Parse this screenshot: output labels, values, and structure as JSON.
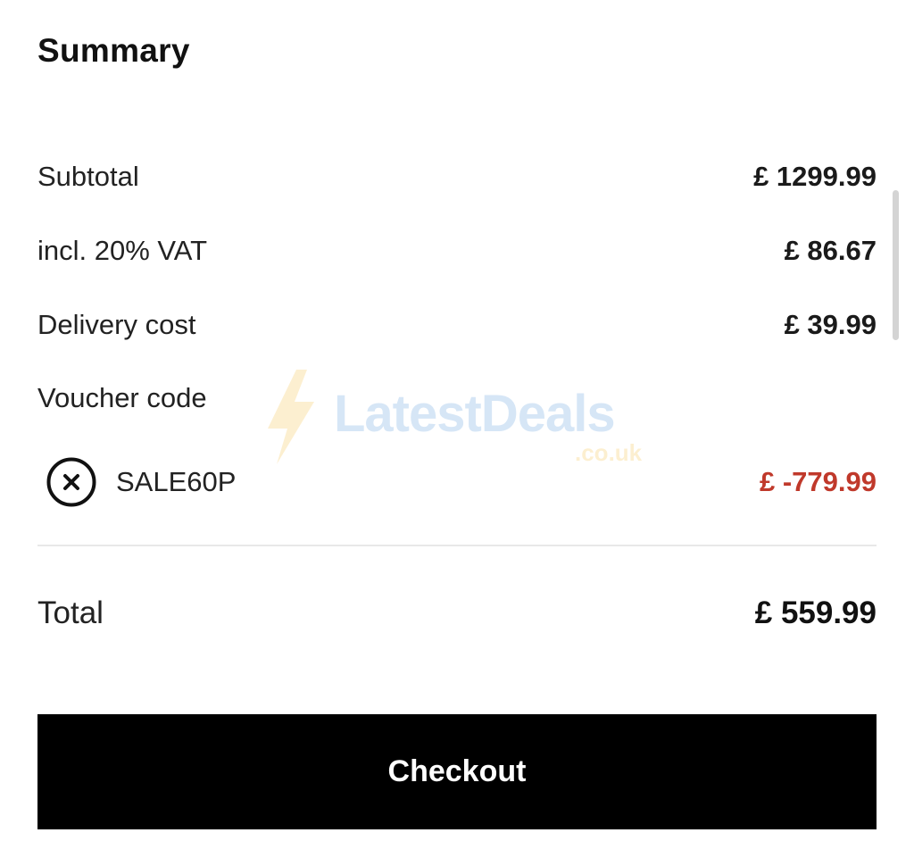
{
  "summary": {
    "title": "Summary",
    "rows": [
      {
        "label": "Subtotal",
        "value": "£ 1299.99"
      },
      {
        "label": "incl. 20% VAT",
        "value": "£ 86.67"
      },
      {
        "label": "Delivery cost",
        "value": "£ 39.99"
      }
    ],
    "voucher": {
      "label": "Voucher code",
      "code": "SALE60P",
      "discount": "£ -779.99",
      "remove_icon": "close-circle-icon"
    },
    "total": {
      "label": "Total",
      "value": "£ 559.99"
    },
    "checkout_label": "Checkout"
  },
  "watermark": {
    "brand": "LatestDeals",
    "domain": ".co.uk",
    "icon": "lightning-bolt-icon"
  },
  "colors": {
    "discount": "#c0392b",
    "button_bg": "#000000",
    "button_text": "#ffffff",
    "divider": "#e8e8e8"
  }
}
